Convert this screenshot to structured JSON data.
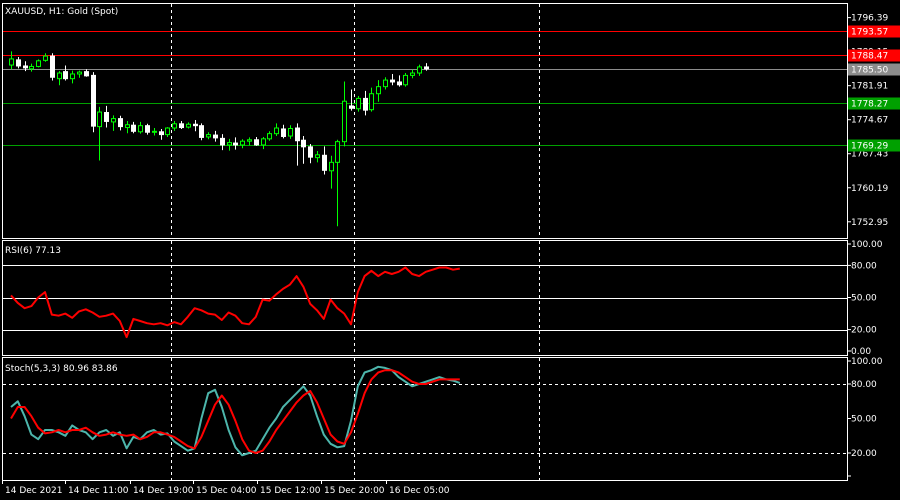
{
  "colors": {
    "background": "#000000",
    "frame": "#ffffff",
    "grid": "#ffffff",
    "text": "#ffffff",
    "candle_up": "#00ff00",
    "candle_down": "#ffffff",
    "resistance": "#ff0000",
    "support": "#00a000",
    "current_price": "#8c8c8c",
    "rsi_line": "#ff0000",
    "stoch_main": "#4db6ac",
    "stoch_signal": "#ff0000"
  },
  "chart_data": [
    {
      "type": "candlestick",
      "title": "XAUUSD, H1:  Gold (Spot)",
      "symbol": "XAUUSD",
      "timeframe": "H1",
      "description": "Gold (Spot)",
      "ylim": [
        1749.5,
        1799.5
      ],
      "y_ticks": [
        1796.39,
        1789.15,
        1781.91,
        1774.67,
        1767.43,
        1760.19,
        1752.95
      ],
      "x_ticks": [
        "14 Dec 2021",
        "14 Dec 11:00",
        "14 Dec 19:00",
        "15 Dec 04:00",
        "15 Dec 12:00",
        "15 Dec 20:00",
        "16 Dec 05:00"
      ],
      "x_tick_index": [
        0,
        8,
        16,
        24,
        32,
        40,
        48
      ],
      "vertical_grid_index": [
        21,
        43,
        66
      ],
      "price_levels": [
        {
          "value": 1793.57,
          "label": "1793.57",
          "kind": "resistance"
        },
        {
          "value": 1788.47,
          "label": "1788.47",
          "kind": "resistance"
        },
        {
          "value": 1785.5,
          "label": "1785.50",
          "kind": "current"
        },
        {
          "value": 1778.27,
          "label": "1778.27",
          "kind": "support"
        },
        {
          "value": 1769.29,
          "label": "1769.29",
          "kind": "support"
        }
      ],
      "candles": [
        {
          "o": 1786.3,
          "h": 1789.2,
          "l": 1785.4,
          "c": 1787.6
        },
        {
          "o": 1787.4,
          "h": 1788.0,
          "l": 1785.6,
          "c": 1786.1
        },
        {
          "o": 1786.1,
          "h": 1787.1,
          "l": 1785.0,
          "c": 1785.7
        },
        {
          "o": 1785.5,
          "h": 1786.6,
          "l": 1784.9,
          "c": 1786.0
        },
        {
          "o": 1786.0,
          "h": 1787.5,
          "l": 1785.8,
          "c": 1787.2
        },
        {
          "o": 1787.3,
          "h": 1788.8,
          "l": 1787.0,
          "c": 1788.2
        },
        {
          "o": 1788.2,
          "h": 1788.8,
          "l": 1783.0,
          "c": 1783.7
        },
        {
          "o": 1783.4,
          "h": 1785.0,
          "l": 1782.0,
          "c": 1784.6
        },
        {
          "o": 1784.9,
          "h": 1786.2,
          "l": 1783.0,
          "c": 1783.4
        },
        {
          "o": 1783.4,
          "h": 1785.1,
          "l": 1782.4,
          "c": 1784.4
        },
        {
          "o": 1784.4,
          "h": 1785.1,
          "l": 1783.6,
          "c": 1784.8
        },
        {
          "o": 1784.9,
          "h": 1785.4,
          "l": 1783.8,
          "c": 1784.0
        },
        {
          "o": 1784.1,
          "h": 1784.8,
          "l": 1772.0,
          "c": 1773.3
        },
        {
          "o": 1773.2,
          "h": 1777.4,
          "l": 1766.0,
          "c": 1776.3
        },
        {
          "o": 1776.2,
          "h": 1777.6,
          "l": 1773.0,
          "c": 1774.3
        },
        {
          "o": 1774.2,
          "h": 1775.6,
          "l": 1772.3,
          "c": 1774.9
        },
        {
          "o": 1774.9,
          "h": 1775.5,
          "l": 1772.4,
          "c": 1773.2
        },
        {
          "o": 1773.0,
          "h": 1774.4,
          "l": 1771.8,
          "c": 1773.6
        },
        {
          "o": 1773.5,
          "h": 1774.2,
          "l": 1771.8,
          "c": 1772.2
        },
        {
          "o": 1772.1,
          "h": 1774.2,
          "l": 1771.7,
          "c": 1773.4
        },
        {
          "o": 1773.4,
          "h": 1773.8,
          "l": 1771.5,
          "c": 1772.0
        },
        {
          "o": 1772.0,
          "h": 1772.9,
          "l": 1771.3,
          "c": 1772.2
        },
        {
          "o": 1772.1,
          "h": 1772.7,
          "l": 1770.4,
          "c": 1771.5
        },
        {
          "o": 1771.5,
          "h": 1773.1,
          "l": 1771.0,
          "c": 1772.9
        },
        {
          "o": 1772.9,
          "h": 1774.4,
          "l": 1772.3,
          "c": 1773.8
        },
        {
          "o": 1773.8,
          "h": 1774.4,
          "l": 1772.7,
          "c": 1773.0
        },
        {
          "o": 1773.1,
          "h": 1774.1,
          "l": 1772.8,
          "c": 1773.7
        },
        {
          "o": 1773.7,
          "h": 1774.6,
          "l": 1772.2,
          "c": 1773.4
        },
        {
          "o": 1773.4,
          "h": 1773.9,
          "l": 1770.3,
          "c": 1770.9
        },
        {
          "o": 1771.0,
          "h": 1772.0,
          "l": 1770.5,
          "c": 1771.5
        },
        {
          "o": 1771.4,
          "h": 1772.3,
          "l": 1770.0,
          "c": 1770.8
        },
        {
          "o": 1770.7,
          "h": 1771.6,
          "l": 1768.2,
          "c": 1769.3
        },
        {
          "o": 1769.3,
          "h": 1770.6,
          "l": 1768.1,
          "c": 1769.8
        },
        {
          "o": 1769.7,
          "h": 1770.9,
          "l": 1768.3,
          "c": 1769.3
        },
        {
          "o": 1769.3,
          "h": 1770.5,
          "l": 1768.6,
          "c": 1770.1
        },
        {
          "o": 1770.1,
          "h": 1770.9,
          "l": 1769.2,
          "c": 1770.4
        },
        {
          "o": 1770.4,
          "h": 1771.0,
          "l": 1769.1,
          "c": 1769.3
        },
        {
          "o": 1769.3,
          "h": 1771.0,
          "l": 1768.4,
          "c": 1770.6
        },
        {
          "o": 1770.6,
          "h": 1772.2,
          "l": 1770.2,
          "c": 1771.7
        },
        {
          "o": 1771.7,
          "h": 1773.9,
          "l": 1771.2,
          "c": 1772.9
        },
        {
          "o": 1772.7,
          "h": 1773.6,
          "l": 1770.7,
          "c": 1771.1
        },
        {
          "o": 1771.2,
          "h": 1773.5,
          "l": 1770.6,
          "c": 1772.8
        },
        {
          "o": 1772.9,
          "h": 1773.9,
          "l": 1764.9,
          "c": 1770.2
        },
        {
          "o": 1770.3,
          "h": 1771.2,
          "l": 1765.3,
          "c": 1768.9
        },
        {
          "o": 1768.9,
          "h": 1769.5,
          "l": 1765.4,
          "c": 1766.7
        },
        {
          "o": 1766.6,
          "h": 1768.0,
          "l": 1765.6,
          "c": 1767.2
        },
        {
          "o": 1767.1,
          "h": 1769.0,
          "l": 1763.0,
          "c": 1763.9
        },
        {
          "o": 1763.8,
          "h": 1767.0,
          "l": 1760.0,
          "c": 1765.6
        },
        {
          "o": 1765.6,
          "h": 1770.4,
          "l": 1752.0,
          "c": 1770.0
        },
        {
          "o": 1770.0,
          "h": 1782.8,
          "l": 1769.0,
          "c": 1778.6
        },
        {
          "o": 1777.6,
          "h": 1781.1,
          "l": 1776.6,
          "c": 1777.1
        },
        {
          "o": 1777.0,
          "h": 1779.7,
          "l": 1776.4,
          "c": 1779.2
        },
        {
          "o": 1779.2,
          "h": 1780.8,
          "l": 1775.6,
          "c": 1776.7
        },
        {
          "o": 1776.8,
          "h": 1781.5,
          "l": 1776.4,
          "c": 1780.2
        },
        {
          "o": 1780.2,
          "h": 1783.1,
          "l": 1778.5,
          "c": 1781.7
        },
        {
          "o": 1781.7,
          "h": 1783.7,
          "l": 1781.1,
          "c": 1783.1
        },
        {
          "o": 1783.1,
          "h": 1784.4,
          "l": 1782.0,
          "c": 1782.7
        },
        {
          "o": 1782.7,
          "h": 1784.1,
          "l": 1781.7,
          "c": 1782.1
        },
        {
          "o": 1782.1,
          "h": 1784.6,
          "l": 1781.7,
          "c": 1784.1
        },
        {
          "o": 1784.1,
          "h": 1785.3,
          "l": 1783.5,
          "c": 1784.6
        },
        {
          "o": 1784.6,
          "h": 1786.4,
          "l": 1784.0,
          "c": 1785.9
        },
        {
          "o": 1785.9,
          "h": 1786.7,
          "l": 1785.1,
          "c": 1785.5
        }
      ]
    },
    {
      "type": "line",
      "title": "RSI(6) 77.13",
      "ylim": [
        0,
        100
      ],
      "y_ticks": [
        100,
        80,
        50,
        20,
        0
      ],
      "y_tick_labels": [
        "100.00",
        "80.00",
        "50.00",
        "20.00",
        "0.00"
      ],
      "levels": [
        80,
        50,
        20
      ],
      "series": [
        {
          "name": "RSI(6)",
          "values": [
            52,
            45,
            40,
            42,
            50,
            55,
            34,
            33,
            35,
            31,
            37,
            39,
            36,
            32,
            33,
            35,
            28,
            13,
            30,
            28,
            26,
            25,
            26,
            24,
            27,
            25,
            32,
            40,
            38,
            35,
            34,
            29,
            36,
            33,
            26,
            25,
            32,
            48,
            47,
            53,
            58,
            62,
            70,
            60,
            44,
            38,
            30,
            48,
            40,
            35,
            25,
            55,
            70,
            75,
            70,
            74,
            72,
            74,
            78,
            72,
            70,
            74,
            76,
            78,
            78,
            76,
            77
          ]
        }
      ]
    },
    {
      "type": "line",
      "title": "Stoch(5,3,3) 80.96 83.86",
      "ylim": [
        0,
        100
      ],
      "y_ticks": [
        100,
        80,
        50,
        20,
        0
      ],
      "y_tick_labels": [
        "100.00",
        "80.00",
        "50.00",
        "20.00",
        ""
      ],
      "levels": [
        80,
        20
      ],
      "series": [
        {
          "name": "Stoch main",
          "values": [
            60,
            65,
            52,
            36,
            32,
            40,
            40,
            38,
            35,
            44,
            40,
            38,
            32,
            38,
            40,
            35,
            38,
            24,
            34,
            32,
            38,
            40,
            36,
            37,
            30,
            26,
            22,
            24,
            50,
            72,
            75,
            60,
            40,
            25,
            18,
            20,
            22,
            32,
            42,
            50,
            60,
            66,
            72,
            78,
            70,
            52,
            36,
            28,
            25,
            26,
            48,
            78,
            90,
            92,
            95,
            94,
            92,
            86,
            82,
            78,
            80,
            82,
            84,
            86,
            84,
            83,
            81
          ]
        },
        {
          "name": "Stoch signal",
          "values": [
            50,
            60,
            60,
            52,
            42,
            37,
            38,
            40,
            38,
            40,
            40,
            42,
            38,
            35,
            36,
            38,
            36,
            35,
            36,
            32,
            34,
            38,
            38,
            36,
            34,
            30,
            26,
            24,
            34,
            48,
            62,
            70,
            62,
            48,
            32,
            22,
            20,
            22,
            30,
            40,
            48,
            56,
            64,
            70,
            74,
            64,
            50,
            36,
            30,
            28,
            38,
            54,
            72,
            84,
            90,
            92,
            92,
            90,
            86,
            82,
            80,
            80,
            82,
            84,
            84,
            84,
            84
          ]
        }
      ]
    }
  ]
}
